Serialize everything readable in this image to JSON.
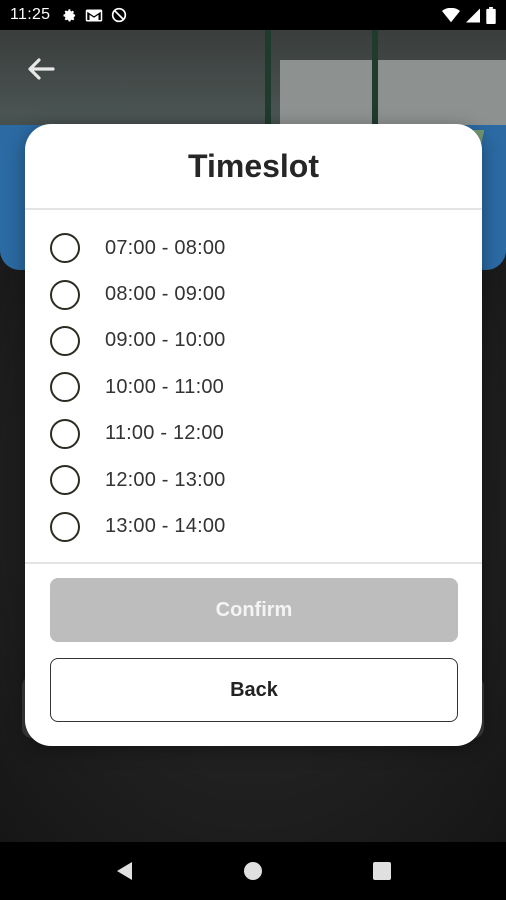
{
  "status_bar": {
    "time": "11:25",
    "left_icons": [
      "gear-icon",
      "gmail-icon",
      "do-not-disturb-icon"
    ],
    "right_icons": [
      "wifi-icon",
      "cell-signal-icon",
      "battery-icon"
    ]
  },
  "header": {
    "back_icon": "arrow-left-icon"
  },
  "dialog": {
    "title": "Timeslot",
    "timeslots": [
      {
        "label": "07:00 - 08:00",
        "selected": false
      },
      {
        "label": "08:00 - 09:00",
        "selected": false
      },
      {
        "label": "09:00 - 10:00",
        "selected": false
      },
      {
        "label": "10:00 - 11:00",
        "selected": false
      },
      {
        "label": "11:00 - 12:00",
        "selected": false
      },
      {
        "label": "12:00 - 13:00",
        "selected": false
      },
      {
        "label": "13:00 - 14:00",
        "selected": false
      }
    ],
    "confirm_label": "Confirm",
    "confirm_enabled": false,
    "back_label": "Back"
  },
  "nav_bar": {
    "icons": [
      "nav-back-icon",
      "nav-home-icon",
      "nav-recents-icon"
    ]
  },
  "colors": {
    "confirm_disabled_bg": "#bdbdbd",
    "radio_border": "#2b2b22",
    "title_text": "#262626"
  }
}
